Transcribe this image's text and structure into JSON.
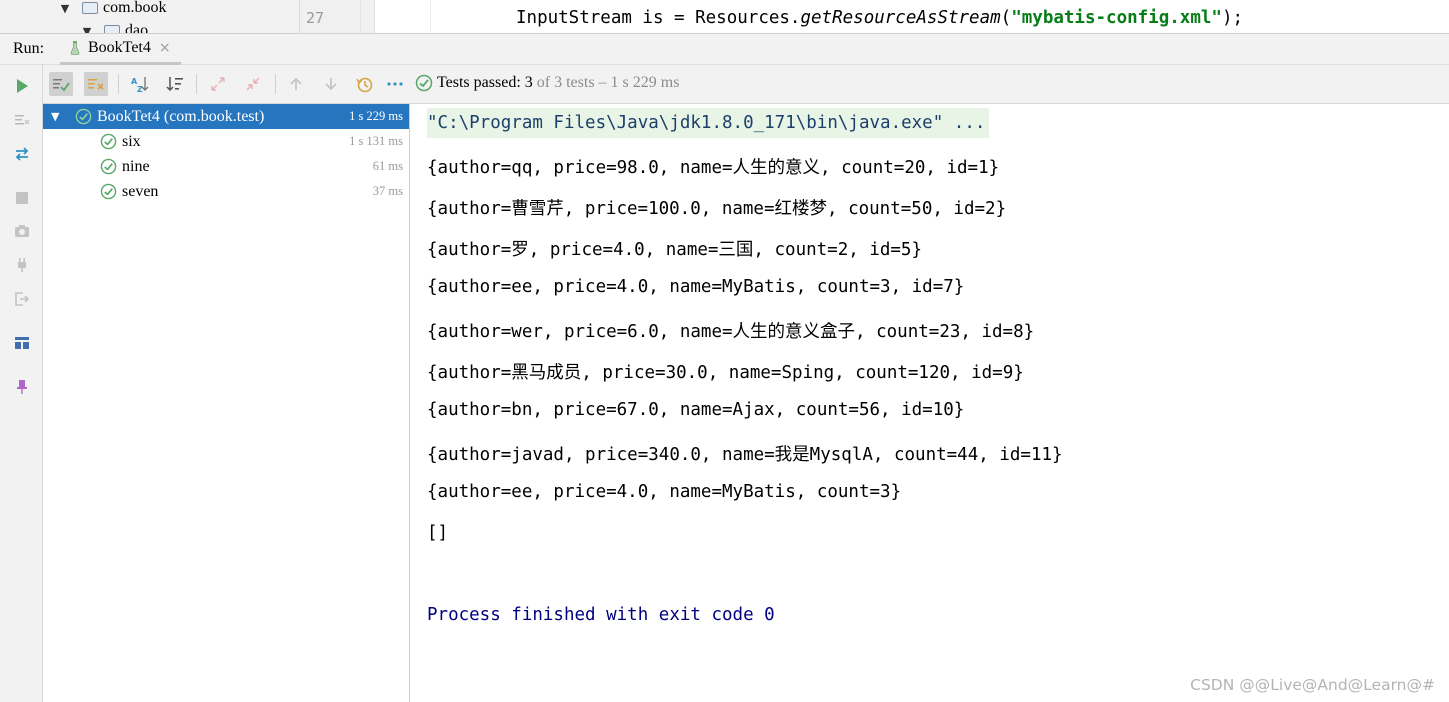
{
  "project_tree": {
    "items": [
      {
        "label": "com.book"
      },
      {
        "label": "dao"
      }
    ]
  },
  "editor": {
    "line_number": "27",
    "code": {
      "prefix": "InputStream is = Resources.",
      "method": "getResourceAsStream",
      "open": "(",
      "string": "\"mybatis-config.xml\"",
      "close": ");"
    }
  },
  "run_window": {
    "label": "Run:",
    "tab": {
      "title": "BookTet4",
      "close": "×"
    }
  },
  "status": {
    "passed_label": "Tests passed: ",
    "passed_count": "3",
    "of_text": " of 3 tests – 1 s 229 ms"
  },
  "test_tree": {
    "root": {
      "name": "BookTet4 (com.book.test)",
      "time": "1 s 229 ms"
    },
    "tests": [
      {
        "name": "six",
        "time": "1 s 131 ms"
      },
      {
        "name": "nine",
        "time": "61 ms"
      },
      {
        "name": "seven",
        "time": "37 ms"
      }
    ]
  },
  "console": {
    "command": "\"C:\\Program Files\\Java\\jdk1.8.0_171\\bin\\java.exe\" ...",
    "lines": [
      "{author=qq, price=98.0, name=人生的意义, count=20, id=1}",
      "{author=曹雪芹, price=100.0, name=红楼梦, count=50, id=2}",
      "{author=罗, price=4.0, name=三国, count=2, id=5}",
      "{author=ee, price=4.0, name=MyBatis, count=3, id=7}",
      "{author=wer, price=6.0, name=人生的意义盒子, count=23, id=8}",
      "{author=黑马成员, price=30.0, name=Sping, count=120, id=9}",
      "{author=bn, price=67.0, name=Ajax, count=56, id=10}",
      "{author=javad, price=340.0, name=我是MysqlA, count=44, id=11}",
      "{author=ee, price=4.0, name=MyBatis, count=3}",
      "[]"
    ],
    "exit": "Process finished with exit code 0"
  },
  "watermark": "CSDN @@Live@And@Learn@#",
  "colors": {
    "accent_selected": "#2675bf",
    "pass_green": "#59a869",
    "run_green": "#59a869",
    "string_green": "#067d17",
    "exit_navy": "#000080"
  }
}
